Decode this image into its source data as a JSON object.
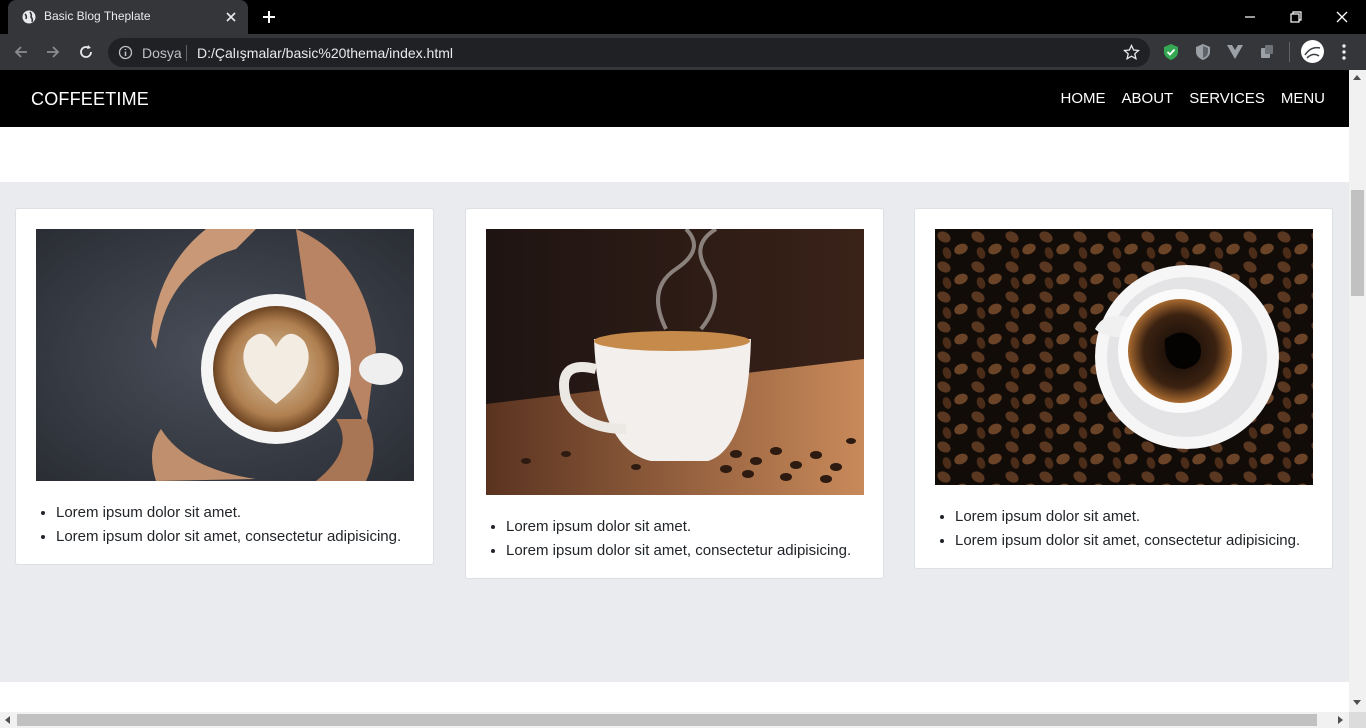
{
  "browser": {
    "tab_title": "Basic Blog Theplate",
    "omnibox_label": "Dosya",
    "url": "D:/Çalışmalar/basic%20thema/index.html"
  },
  "site": {
    "brand": "COFFEETIME",
    "nav": [
      "HOME",
      "ABOUT",
      "SERVICES",
      "MENU"
    ]
  },
  "cards": [
    {
      "image": "coffee-latte-heart-image",
      "items": [
        "Lorem ipsum dolor sit amet.",
        "Lorem ipsum dolor sit amet, consectetur adipisicing."
      ]
    },
    {
      "image": "coffee-steaming-cup-image",
      "items": [
        "Lorem ipsum dolor sit amet.",
        "Lorem ipsum dolor sit amet, consectetur adipisicing."
      ]
    },
    {
      "image": "coffee-beans-cup-image",
      "items": [
        "Lorem ipsum dolor sit amet.",
        "Lorem ipsum dolor sit amet, consectetur adipisicing."
      ]
    }
  ],
  "colors": {
    "nav_background": "#000000",
    "page_background": "#e9ebee",
    "card_background": "#ffffff"
  }
}
